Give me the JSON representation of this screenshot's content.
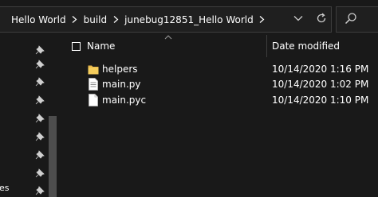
{
  "address_bar": {
    "crumbs": [
      "Hello World",
      "build",
      "junebug12851_Hello World"
    ],
    "dropdown_icon": "chevron-down-icon",
    "refresh_icon": "refresh-icon"
  },
  "search": {
    "icon": "search-icon"
  },
  "nav": {
    "pinned_count": 8,
    "partial_label": "es"
  },
  "columns": {
    "name": "Name",
    "date_modified": "Date modified"
  },
  "files": [
    {
      "name": "helpers",
      "date": "10/14/2020 1:16 PM",
      "type": "folder"
    },
    {
      "name": "main.py",
      "date": "10/14/2020 1:02 PM",
      "type": "file"
    },
    {
      "name": "main.pyc",
      "date": "10/14/2020 1:10 PM",
      "type": "file"
    }
  ],
  "colors": {
    "background": "#191919",
    "border": "#3d3d3d",
    "folder": "#e8b84a",
    "text": "#ffffff"
  }
}
